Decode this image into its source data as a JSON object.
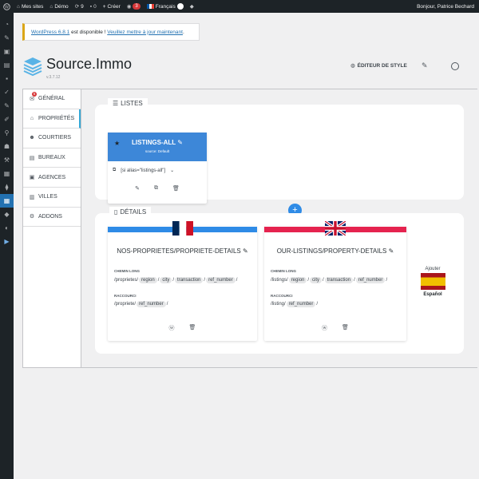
{
  "adminbar": {
    "my_sites": "Mes sites",
    "site_name": "Démo",
    "updates_count": "9",
    "comments_count": "0",
    "new_label": "Créer",
    "notif_count": "3",
    "language": "Français",
    "greeting": "Bonjour, Patrice Bechard"
  },
  "notice": {
    "version_link": "WordPress 6.8.1",
    "text": " est disponible ! ",
    "update_link": "Veuillez mettre à jour maintenant",
    "end": "."
  },
  "plugin": {
    "title": "Source.Immo",
    "version": "v.3.7.12",
    "style_editor": "ÉDITEUR DE STYLE"
  },
  "nav": {
    "items": [
      {
        "label": "GÉNÉRAL",
        "icon": "envelope-icon",
        "badge": "5"
      },
      {
        "label": "PROPRIÉTÉS",
        "icon": "home-icon"
      },
      {
        "label": "COURTIERS",
        "icon": "user-icon"
      },
      {
        "label": "BUREAUX",
        "icon": "building-icon"
      },
      {
        "label": "AGENCES",
        "icon": "agency-icon"
      },
      {
        "label": "VILLES",
        "icon": "city-icon"
      },
      {
        "label": "ADDONS",
        "icon": "gears-icon"
      }
    ]
  },
  "lists": {
    "title": "LISTES",
    "card": {
      "name": "LISTINGS-ALL",
      "source": "source: Default",
      "shortcode": "[si alias=\"listings-all\"]"
    }
  },
  "details": {
    "title": "DÉTAILS",
    "long_label": "CHEMIN LONG",
    "short_label": "RACCOURCI",
    "cards": [
      {
        "name": "NOS-PROPRIETES/PROPRIETE-DETAILS",
        "bar_color": "#2f8be6",
        "long_prefix": "/proprietes/",
        "long_tokens": [
          "region",
          "city",
          "transaction",
          "ref_number"
        ],
        "short_prefix": "/propriete/",
        "short_tokens": [
          "ref_number"
        ]
      },
      {
        "name": "OUR-LISTINGS/PROPERTY-DETAILS",
        "bar_color": "#e5234f",
        "long_prefix": "/listings/",
        "long_tokens": [
          "region",
          "city",
          "transaction",
          "ref_number"
        ],
        "short_prefix": "/listing/",
        "short_tokens": [
          "ref_number"
        ]
      }
    ],
    "add_label": "Ajouter",
    "add_language": "Español"
  }
}
